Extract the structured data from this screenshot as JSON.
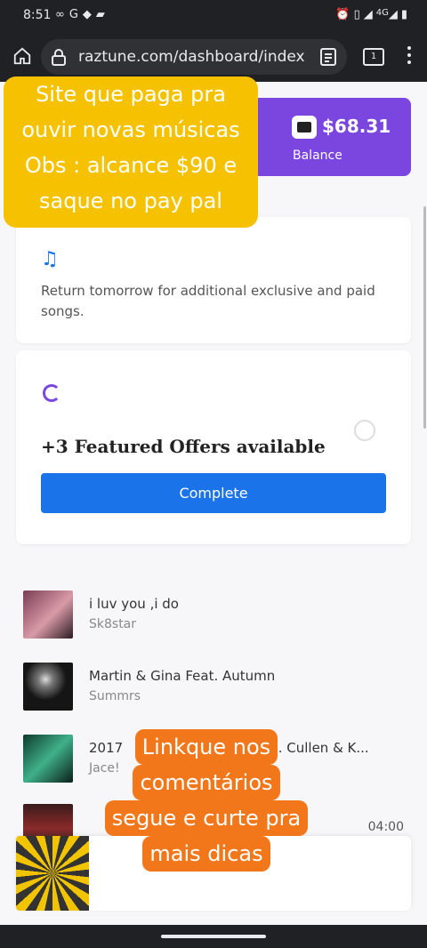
{
  "status_bar": {
    "time": "8:51",
    "network": "4G"
  },
  "browser": {
    "url": "raztune.com/dashboard/index",
    "tab_count": "1"
  },
  "balance": {
    "amount": "$68.31",
    "label": "Balance"
  },
  "info_card": {
    "text": "Return tomorrow for additional exclusive and paid songs."
  },
  "offers_card": {
    "title": "+3 Featured Offers available",
    "button_label": "Complete"
  },
  "songs": [
    {
      "title": "i luv you ,i do",
      "artist": "Sk8star"
    },
    {
      "title": "Martin & Gina Feat. Autumn",
      "artist": "Summrs"
    },
    {
      "title": "2017",
      "title_tail": "rod. Cullen & K...",
      "artist": "Jace!"
    }
  ],
  "player": {
    "duration": "04:00"
  },
  "overlays": {
    "yellow": [
      "Site que paga pra",
      "ouvir novas músicas",
      "Obs : alcance $90 e",
      "saque no pay pal"
    ],
    "orange": [
      "Linkque nos",
      "comentários",
      "segue e curte  pra",
      "mais dicas"
    ]
  },
  "colors": {
    "accent_purple": "#7b45e0",
    "button_blue": "#1a73e8",
    "overlay_yellow": "#f6c200",
    "overlay_orange": "#f2761a"
  }
}
